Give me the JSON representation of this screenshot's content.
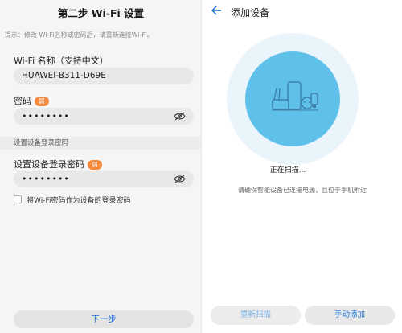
{
  "left": {
    "title": "第二步 Wi-Fi 设置",
    "hint": "提示：修改 Wi-Fi名称或密码后，请重新连接Wi-Fi。",
    "wifi_name_label": "Wi-Fi 名称（支持中文）",
    "wifi_name_value": "HUAWEI-B311-D69E",
    "password_label": "密码",
    "password_strength": "弱",
    "password_value": "••••••••",
    "section_header": "设置设备登录密码",
    "login_password_label": "设置设备登录密码",
    "login_password_strength": "弱",
    "login_password_value": "••••••••",
    "checkbox_label": "将Wi-Fi密码作为设备的登录密码",
    "next_button": "下一步"
  },
  "right": {
    "title": "添加设备",
    "status": "正在扫描...",
    "note": "请确保智能设备已连接电源，且位于手机附近",
    "rescan_button": "重新扫描",
    "manual_add_button": "手动添加"
  },
  "colors": {
    "accent": "#1d73d2",
    "badge": "#f58a3c",
    "scan_inner": "#5fc0ea",
    "scan_outer": "#eaf4fb"
  },
  "icons": [
    "eye-off-icon",
    "back-arrow-icon",
    "smart-devices-icon"
  ]
}
